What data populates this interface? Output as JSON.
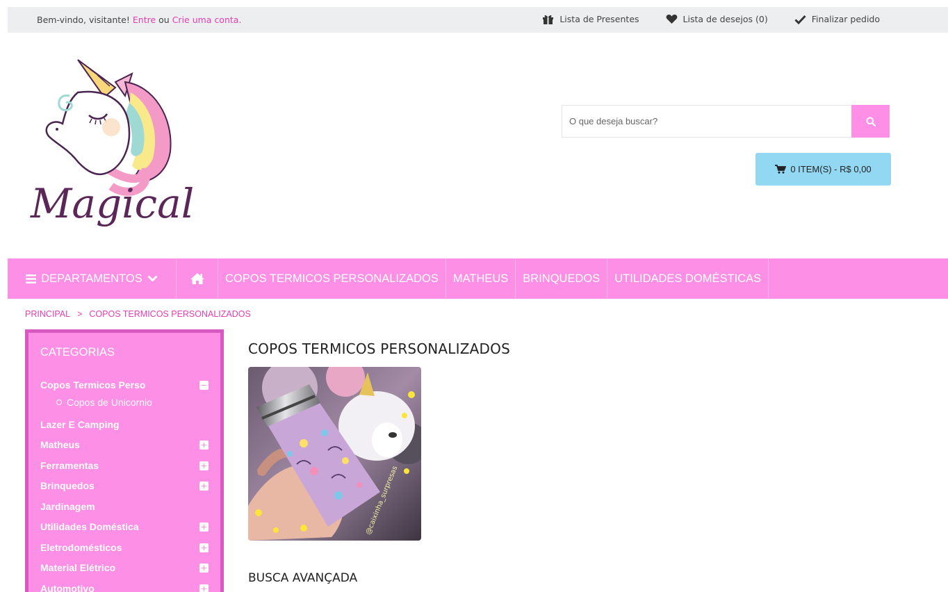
{
  "topbar": {
    "welcome_prefix": "Bem-vindo, visitante!",
    "login_link": "Entre",
    "or_text": "ou",
    "signup_link": "Crie uma conta.",
    "gift_list": "Lista de Presentes",
    "wishlist": "Lista de desejos (0)",
    "checkout": "Finalizar pedido"
  },
  "logo": {
    "text": "Magical"
  },
  "search": {
    "placeholder": "O que deseja buscar?"
  },
  "cart": {
    "label": "0 ITEM(S) - R$ 0,00"
  },
  "nav": {
    "departments": "DEPARTAMENTOS",
    "items": [
      "COPOS TERMICOS PERSONALIZADOS",
      "MATHEUS",
      "BRINQUEDOS",
      "UTILIDADES DOMÉSTICAS"
    ]
  },
  "breadcrumb": {
    "home": "PRINCIPAL",
    "separator": ">",
    "current": "COPOS TERMICOS PERSONALIZADOS"
  },
  "sidebar": {
    "title": "CATEGORIAS",
    "categories": [
      {
        "label": "Copos Termicos Perso",
        "toggle": "minus"
      },
      {
        "label": "Lazer E Camping",
        "toggle": "none"
      },
      {
        "label": "Matheus",
        "toggle": "plus"
      },
      {
        "label": "Ferramentas",
        "toggle": "plus"
      },
      {
        "label": "Brinquedos",
        "toggle": "plus"
      },
      {
        "label": "Jardinagem",
        "toggle": "none"
      },
      {
        "label": "Utilidades Doméstica",
        "toggle": "plus"
      },
      {
        "label": "Eletrodomésticos",
        "toggle": "plus"
      },
      {
        "label": "Material Elétrico",
        "toggle": "plus"
      },
      {
        "label": "Automotivo",
        "toggle": "plus"
      }
    ],
    "subcategory": "Copos de Unicornio"
  },
  "main": {
    "title": "COPOS TERMICOS PERSONALIZADOS",
    "image_watermark": "@caixinha_surpresas",
    "advanced_search": "BUSCA AVANÇADA"
  },
  "colors": {
    "brand_pink": "#fd90e6",
    "link_pink": "#e33fb2",
    "cart_blue": "#92d8f2",
    "sidebar_border": "#d75ac0"
  }
}
